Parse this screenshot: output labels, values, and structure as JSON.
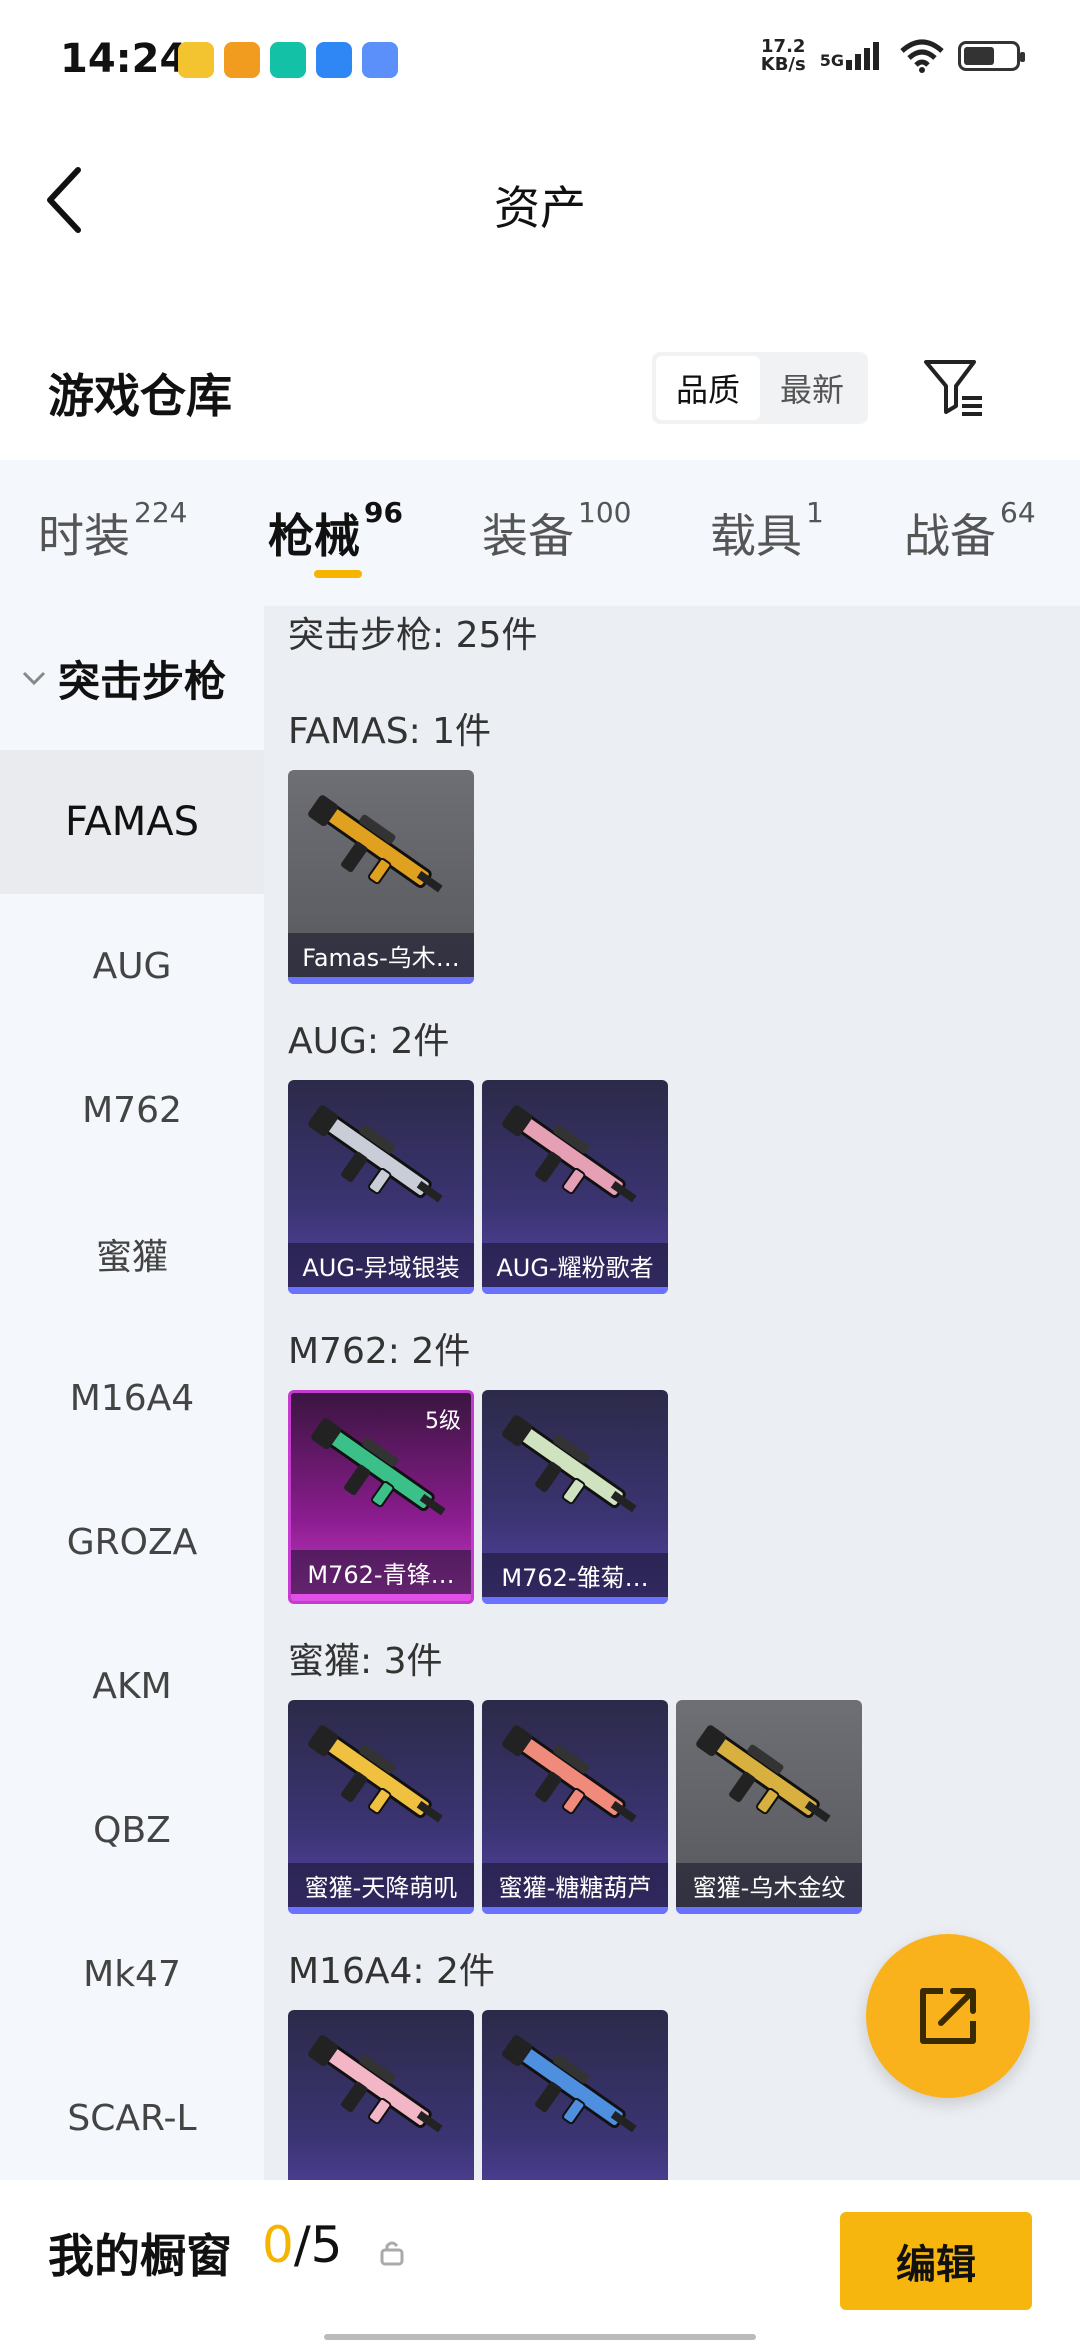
{
  "status": {
    "time": "14:24",
    "speed_value": "17.2",
    "speed_unit": "KB/s",
    "network": "5G",
    "app_icon_colors": [
      "#f4c430",
      "#f29c1f",
      "#13c2a6",
      "#2f87f5",
      "#5b8ff9"
    ]
  },
  "header": {
    "title": "资产"
  },
  "warehouse": {
    "title": "游戏仓库",
    "sort_options": [
      "品质",
      "最新"
    ]
  },
  "tabs": [
    {
      "label": "时装",
      "count": "224"
    },
    {
      "label": "枪械",
      "count": "96"
    },
    {
      "label": "装备",
      "count": "100"
    },
    {
      "label": "载具",
      "count": "1"
    },
    {
      "label": "战备",
      "count": "64"
    }
  ],
  "sidebar": {
    "category": "突击步枪",
    "items": [
      "FAMAS",
      "AUG",
      "M762",
      "蜜獾",
      "M16A4",
      "GROZA",
      "AKM",
      "QBZ",
      "Mk47",
      "SCAR-L"
    ]
  },
  "content": {
    "summary": "突击步枪: 25件",
    "groups": [
      {
        "label": "FAMAS: 1件",
        "items": [
          {
            "name": "Famas-乌木…",
            "rarity": "grey",
            "gun_color": "#e0a020"
          }
        ]
      },
      {
        "label": "AUG: 2件",
        "items": [
          {
            "name": "AUG-异域银装",
            "rarity": "purple",
            "gun_color": "#c8cdd8"
          },
          {
            "name": "AUG-耀粉歌者",
            "rarity": "purple",
            "gun_color": "#e6a0b6"
          }
        ]
      },
      {
        "label": "M762: 2件",
        "items": [
          {
            "name": "M762-青锋…",
            "rarity": "magenta",
            "level": "5级",
            "gun_color": "#3cc08a"
          },
          {
            "name": "M762-雏菊…",
            "rarity": "purple",
            "gun_color": "#cfe3c0"
          }
        ]
      },
      {
        "label": "蜜獾: 3件",
        "items": [
          {
            "name": "蜜獾-天降萌叽",
            "rarity": "purple",
            "gun_color": "#f0c040"
          },
          {
            "name": "蜜獾-糖糖葫芦",
            "rarity": "purple",
            "gun_color": "#f08a7a"
          },
          {
            "name": "蜜獾-乌木金纹",
            "rarity": "grey",
            "gun_color": "#d8b040"
          }
        ]
      },
      {
        "label": "M16A4: 2件",
        "items": [
          {
            "name": "",
            "rarity": "purple",
            "gun_color": "#f2b6c6"
          },
          {
            "name": "",
            "rarity": "purple",
            "gun_color": "#4f8fe0"
          }
        ]
      }
    ]
  },
  "showcase": {
    "title": "我的橱窗",
    "current": "0",
    "total": "/5",
    "edit_label": "编辑"
  }
}
